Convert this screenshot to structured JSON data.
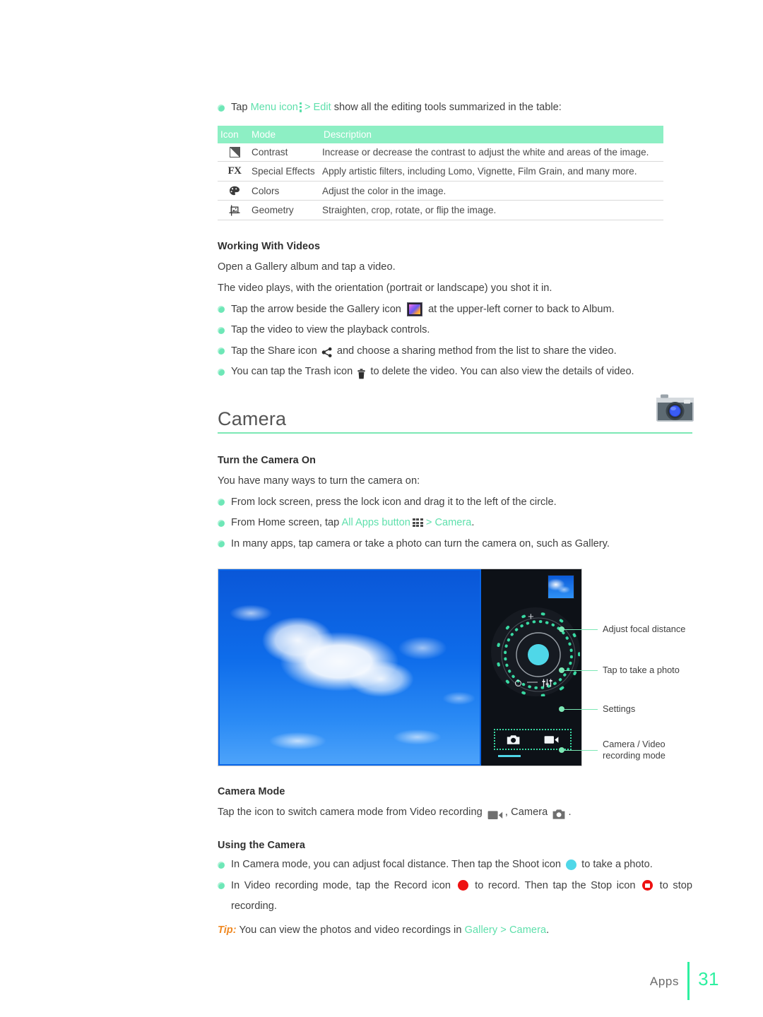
{
  "intro": {
    "lead_prefix": "Tap ",
    "lead_menu": "Menu icon",
    "lead_edit": "> Edit",
    "lead_suffix": " show all the editing tools summarized in the table:"
  },
  "edit_table": {
    "headers": [
      "Icon",
      "Mode",
      "Description"
    ],
    "rows": [
      {
        "icon": "contrast-icon",
        "mode": "Contrast",
        "description": "Increase or decrease the contrast to adjust the white and areas of the image."
      },
      {
        "icon": "fx-icon",
        "mode": "Special Effects",
        "description": "Apply artistic filters, including Lomo, Vignette, Film Grain, and many more."
      },
      {
        "icon": "colors-palette-icon",
        "mode": "Colors",
        "description": "Adjust the color in the image."
      },
      {
        "icon": "geometry-crop-icon",
        "mode": "Geometry",
        "description": "Straighten, crop, rotate, or flip the image."
      }
    ]
  },
  "videos": {
    "heading": "Working With Videos",
    "p1": "Open a Gallery album and tap a video.",
    "p2": "The video plays, with the orientation (portrait or landscape) you shot it in.",
    "b1_a": "Tap the arrow beside the Gallery icon",
    "b1_b": "at the upper-left corner to back to Album.",
    "b2": "Tap the video to view the playback controls.",
    "b3_a": "Tap the Share icon",
    "b3_b": "and choose a sharing method from the list to share the video.",
    "b4_a": "You can tap the Trash icon",
    "b4_b": "to delete the video. You can also view the details of video."
  },
  "camera": {
    "title": "Camera",
    "app_icon": "camera-app-icon",
    "turn_on_heading": "Turn the Camera On",
    "turn_on_intro": "You have many ways to turn the camera on:",
    "b1": "From lock screen, press the lock icon and drag it to the left of the circle.",
    "b2_a": "From Home screen, tap ",
    "b2_link": "All Apps button",
    "b2_link2": "> Camera",
    "b2_end": ".",
    "b3": "In many apps, tap camera or take a photo can turn the camera on, such as Gallery."
  },
  "screenshot": {
    "callouts": [
      "Adjust focal distance",
      "Tap to take a photo",
      "Settings",
      "Camera / Video\nrecording mode"
    ],
    "callout_4_line1": "Camera / Video",
    "callout_4_line2": "recording mode"
  },
  "camera_mode": {
    "heading": "Camera Mode",
    "line_a": "Tap the icon to switch camera mode from Video recording",
    "line_b": ", Camera",
    "line_c": "."
  },
  "using_camera": {
    "heading": "Using the Camera",
    "b1_a": "In Camera mode, you can adjust focal distance. Then tap the Shoot icon",
    "b1_b": "to take a photo.",
    "b2_a": "In Video recording mode, tap the Record icon",
    "b2_b": "to record. Then tap the Stop icon",
    "b2_c": "to stop recording.",
    "tip_word": "Tip:",
    "tip_text": " You can view the photos and video recordings in ",
    "tip_link": "Gallery > Camera",
    "tip_end": "."
  },
  "footer": {
    "label": "Apps",
    "page": "31"
  },
  "colors": {
    "mint": "#5fe0ac",
    "mint_header": "#8defc4",
    "accent_green": "#2ef0a0",
    "tip_orange": "#f08a24",
    "shoot_cyan": "#4fd7e8",
    "record_red": "#ee1111"
  }
}
